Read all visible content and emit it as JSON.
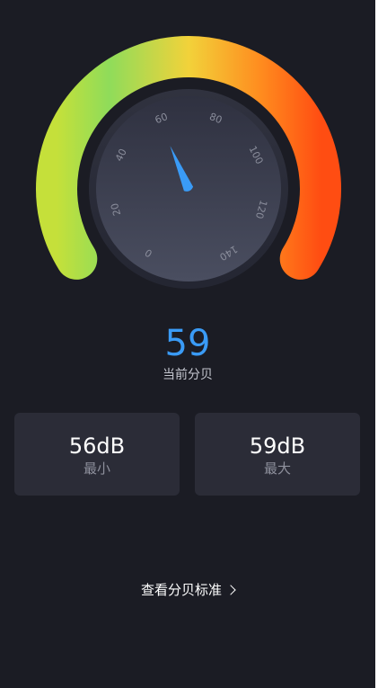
{
  "gauge": {
    "min": 0,
    "max": 140,
    "value": 59,
    "ticks": [
      "0",
      "20",
      "40",
      "60",
      "80",
      "100",
      "120",
      "140"
    ]
  },
  "reading": {
    "value": "59",
    "label": "当前分贝"
  },
  "stats": {
    "min": {
      "value": "56dB",
      "label": "最小"
    },
    "max": {
      "value": "59dB",
      "label": "最大"
    }
  },
  "footer": {
    "standard_link": "查看分贝标准"
  },
  "colors": {
    "background": "#1b1c24",
    "accent": "#3a9bf6",
    "arc_start": "#c5e03a",
    "arc_green": "#8fdc5a",
    "arc_yellow": "#f2d23a",
    "arc_orange": "#ff8a1e",
    "arc_end": "#ff4d12",
    "card": "#2b2c37",
    "dial_face": "#3a3d4c"
  }
}
